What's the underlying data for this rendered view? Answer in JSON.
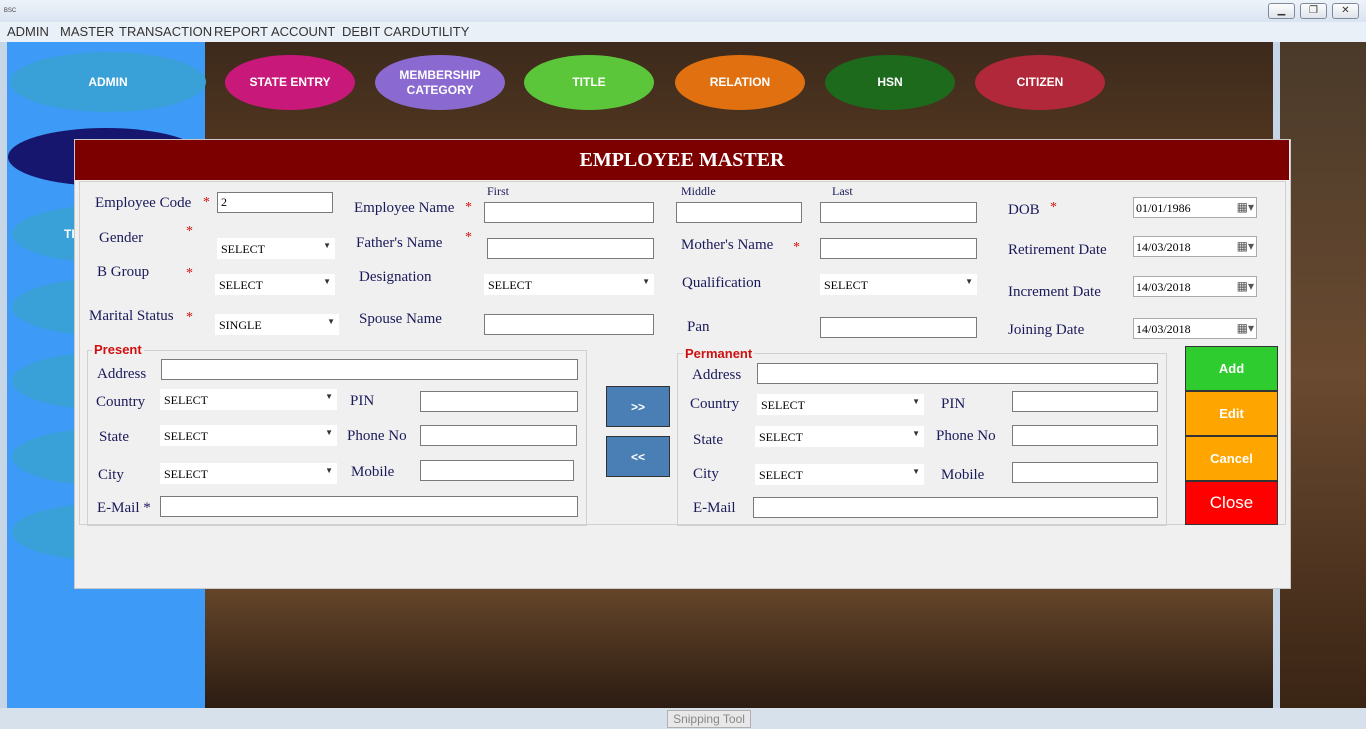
{
  "window": {
    "icon": "BSC",
    "buttons": [
      "▁",
      "❐",
      "✕"
    ]
  },
  "menu": [
    "ADMIN",
    "MASTER",
    "TRANSACTION",
    "REPORT",
    "ACCOUNT",
    "DEBIT CARD",
    "UTILITY"
  ],
  "sidebar": {
    "admin": "ADMIN",
    "partial": "TI"
  },
  "tabs": {
    "state": "STATE ENTRY",
    "membership1": "MEMBERSHIP",
    "membership2": "CATEGORY",
    "title": "TITLE",
    "relation": "RELATION",
    "hsn": "HSN",
    "citizen": "CITIZEN"
  },
  "dialog": {
    "title": "EMPLOYEE MASTER",
    "employee_code": {
      "label": "Employee Code",
      "value": "2"
    },
    "employee_name": {
      "label": "Employee Name",
      "first": "First",
      "middle": "Middle",
      "last": "Last"
    },
    "dob": {
      "label": "DOB",
      "value": "01/01/1986"
    },
    "gender": {
      "label": "Gender",
      "value": "SELECT"
    },
    "father": {
      "label": "Father's Name"
    },
    "mother": {
      "label": "Mother's Name"
    },
    "retirement": {
      "label": "Retirement Date",
      "value": "14/03/2018"
    },
    "bgroup": {
      "label": "B Group",
      "value": "SELECT"
    },
    "designation": {
      "label": "Designation",
      "value": "SELECT"
    },
    "qualification": {
      "label": "Qualification",
      "value": "SELECT"
    },
    "increment": {
      "label": "Increment Date",
      "value": "14/03/2018"
    },
    "marital": {
      "label": "Marital Status",
      "value": "SINGLE"
    },
    "spouse": {
      "label": "Spouse Name"
    },
    "pan": {
      "label": "Pan"
    },
    "joining": {
      "label": "Joining Date",
      "value": "14/03/2018"
    },
    "present": {
      "title": "Present",
      "address": "Address",
      "country": "Country",
      "state": "State",
      "city": "City",
      "email": "E-Mail *",
      "pin": "PIN",
      "phone": "Phone No",
      "mobile": "Mobile",
      "sel": "SELECT"
    },
    "permanent": {
      "title": "Permanent",
      "address": "Address",
      "country": "Country",
      "state": "State",
      "city": "City",
      "email": "E-Mail",
      "pin": "PIN",
      "phone": "Phone No",
      "mobile": "Mobile",
      "sel": "SELECT"
    },
    "copy_right": ">>",
    "copy_left": "<<",
    "buttons": {
      "add": "Add",
      "edit": "Edit",
      "cancel": "Cancel",
      "close": "Close"
    },
    "star": "*"
  },
  "snipping": "Snipping Tool",
  "colors": {
    "dialog_title_bg": "#7c0000",
    "sidebar": "#3d9af6",
    "add": "#2ecc2e",
    "edit": "#ffa500",
    "cancel": "#ffa500",
    "close": "#ff0000"
  }
}
